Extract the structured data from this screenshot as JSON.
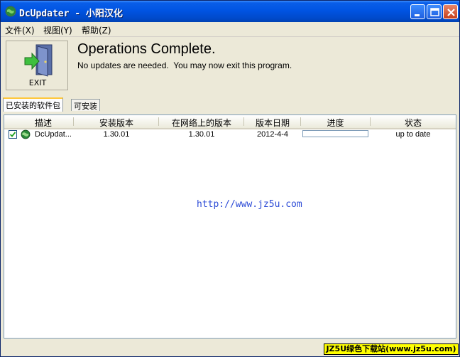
{
  "window": {
    "title": "DcUpdater - 小阳汉化",
    "controls": {
      "minimize": "minimize-icon",
      "maximize": "maximize-icon",
      "close": "close-icon"
    }
  },
  "menu": {
    "items": [
      {
        "label": "文件(X)"
      },
      {
        "label": "视图(Y)"
      },
      {
        "label": "帮助(Z)"
      }
    ]
  },
  "header": {
    "exit_label": "EXIT",
    "title": "Operations Complete.",
    "message": "No updates are needed.  You may now exit this program."
  },
  "tabs": [
    {
      "label": "已安装的软件包",
      "active": true
    },
    {
      "label": "可安装",
      "active": false
    }
  ],
  "table": {
    "columns": [
      "描述",
      "安装版本",
      "在网络上的版本",
      "版本日期",
      "进度",
      "状态"
    ],
    "rows": [
      {
        "checked": true,
        "description": "DcUpdat...",
        "installed_version": "1.30.01",
        "online_version": "1.30.01",
        "release_date": "2012-4-4",
        "progress": 0,
        "status": "up to date"
      }
    ]
  },
  "watermark": {
    "url": "http://www.jz5u.com",
    "badge": "JZ5U绿色下载站(www.jz5u.com)"
  },
  "colors": {
    "titlebar": "#0054e3",
    "watermark_url": "#2b4ad6",
    "badge_bg": "#ffff00",
    "checkbox_check": "#21a121"
  }
}
